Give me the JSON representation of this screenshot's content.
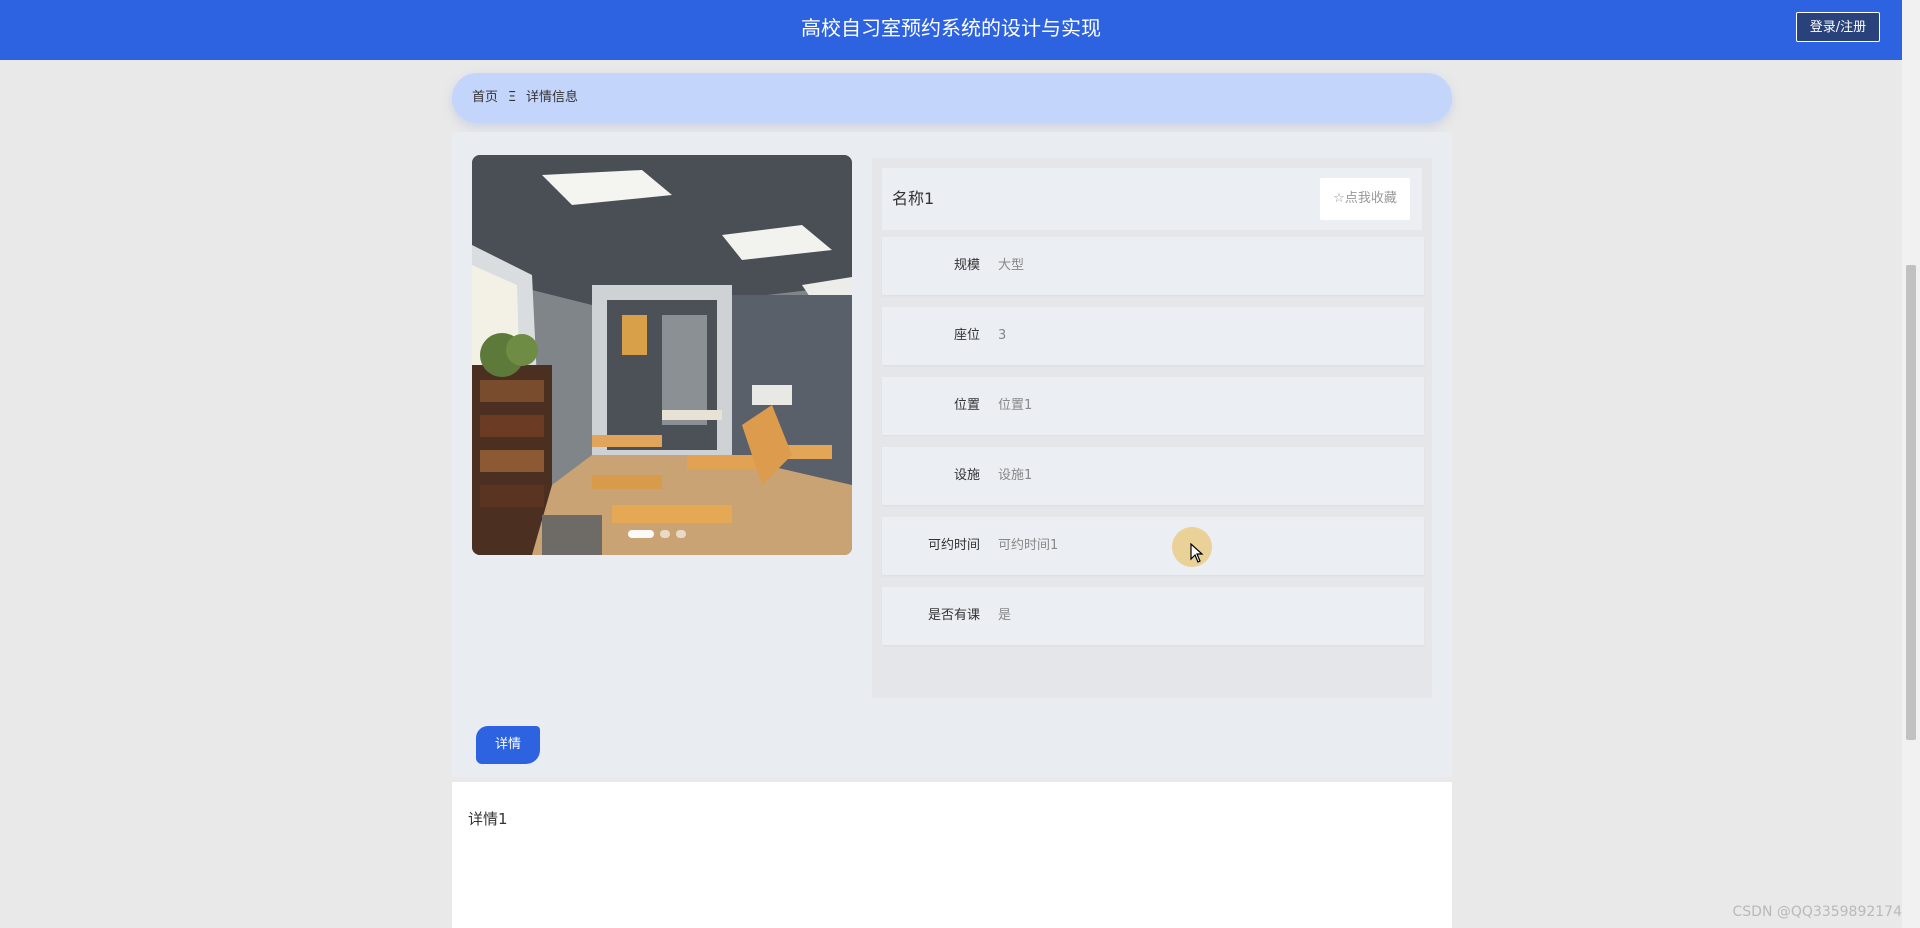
{
  "header": {
    "title": "高校自习室预约系统的设计与实现",
    "login_label": "登录/注册",
    "color": "#2d62e0"
  },
  "breadcrumb": {
    "home": "首页",
    "separator": "Ξ",
    "current": "详情信息"
  },
  "carousel": {
    "prev_icon": "chevron-left-icon",
    "next_icon": "chevron-right-icon",
    "indicator_count": 3,
    "active_index": 0
  },
  "info": {
    "name": "名称1",
    "favorite_label": "☆点我收藏",
    "fields": [
      {
        "label": "规模",
        "value": "大型"
      },
      {
        "label": "座位",
        "value": "3"
      },
      {
        "label": "位置",
        "value": "位置1"
      },
      {
        "label": "设施",
        "value": "设施1"
      },
      {
        "label": "可约时间",
        "value": "可约时间1"
      },
      {
        "label": "是否有课",
        "value": "是"
      }
    ]
  },
  "detail": {
    "tab_label": "详情",
    "content": "详情1"
  },
  "watermark": "CSDN @QQ3359892174"
}
